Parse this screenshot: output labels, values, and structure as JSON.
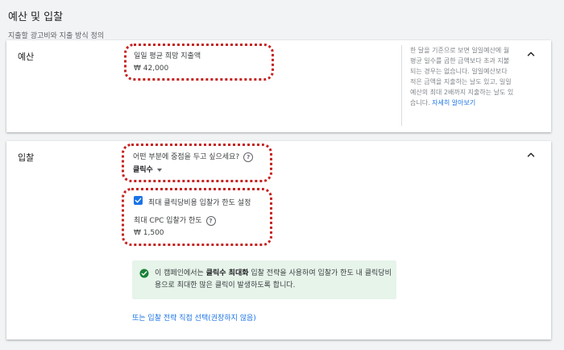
{
  "header": {
    "title": "예산 및 입찰",
    "subtitle": "지출할 광고비와 지출 방식 정의"
  },
  "budget": {
    "label": "예산",
    "field_label": "일일 평균 희망 지출액",
    "value": "₩ 42,000",
    "note_text": "한 달을 기준으로 보면 일일예산에 월 평균 일수를 곱한 금액보다 초과 지불되는 경우는 없습니다. 일일예산보다 적은 금액을 지출하는 날도 있고, 일일예산의 최대 2배까지 지출하는 날도 있습니다.",
    "note_link": "자세히 알아보기"
  },
  "bidding": {
    "label": "입찰",
    "question": "어떤 부분에 중점을 두고 싶으세요?",
    "focus_value": "클릭수",
    "checkbox_label": "최대 클릭당비용 입찰가 한도 설정",
    "cpc_label": "최대 CPC 입찰가 한도",
    "cpc_value": "₩ 1,500",
    "info_pre": "이 캠페인에서는 ",
    "info_bold": "클릭수 최대화",
    "info_post": " 입찰 전략을 사용하여 입찰가 한도 내 클릭당비용으로 최대한 많은 클릭이 발생하도록 합니다.",
    "alt_link": "또는 입찰 전략 직접 선택(권장하지 않음)"
  },
  "colors": {
    "accent": "#1a73e8",
    "annotation": "#c5221f",
    "success_bg": "#e6f4ea",
    "success_icon": "#188038"
  }
}
